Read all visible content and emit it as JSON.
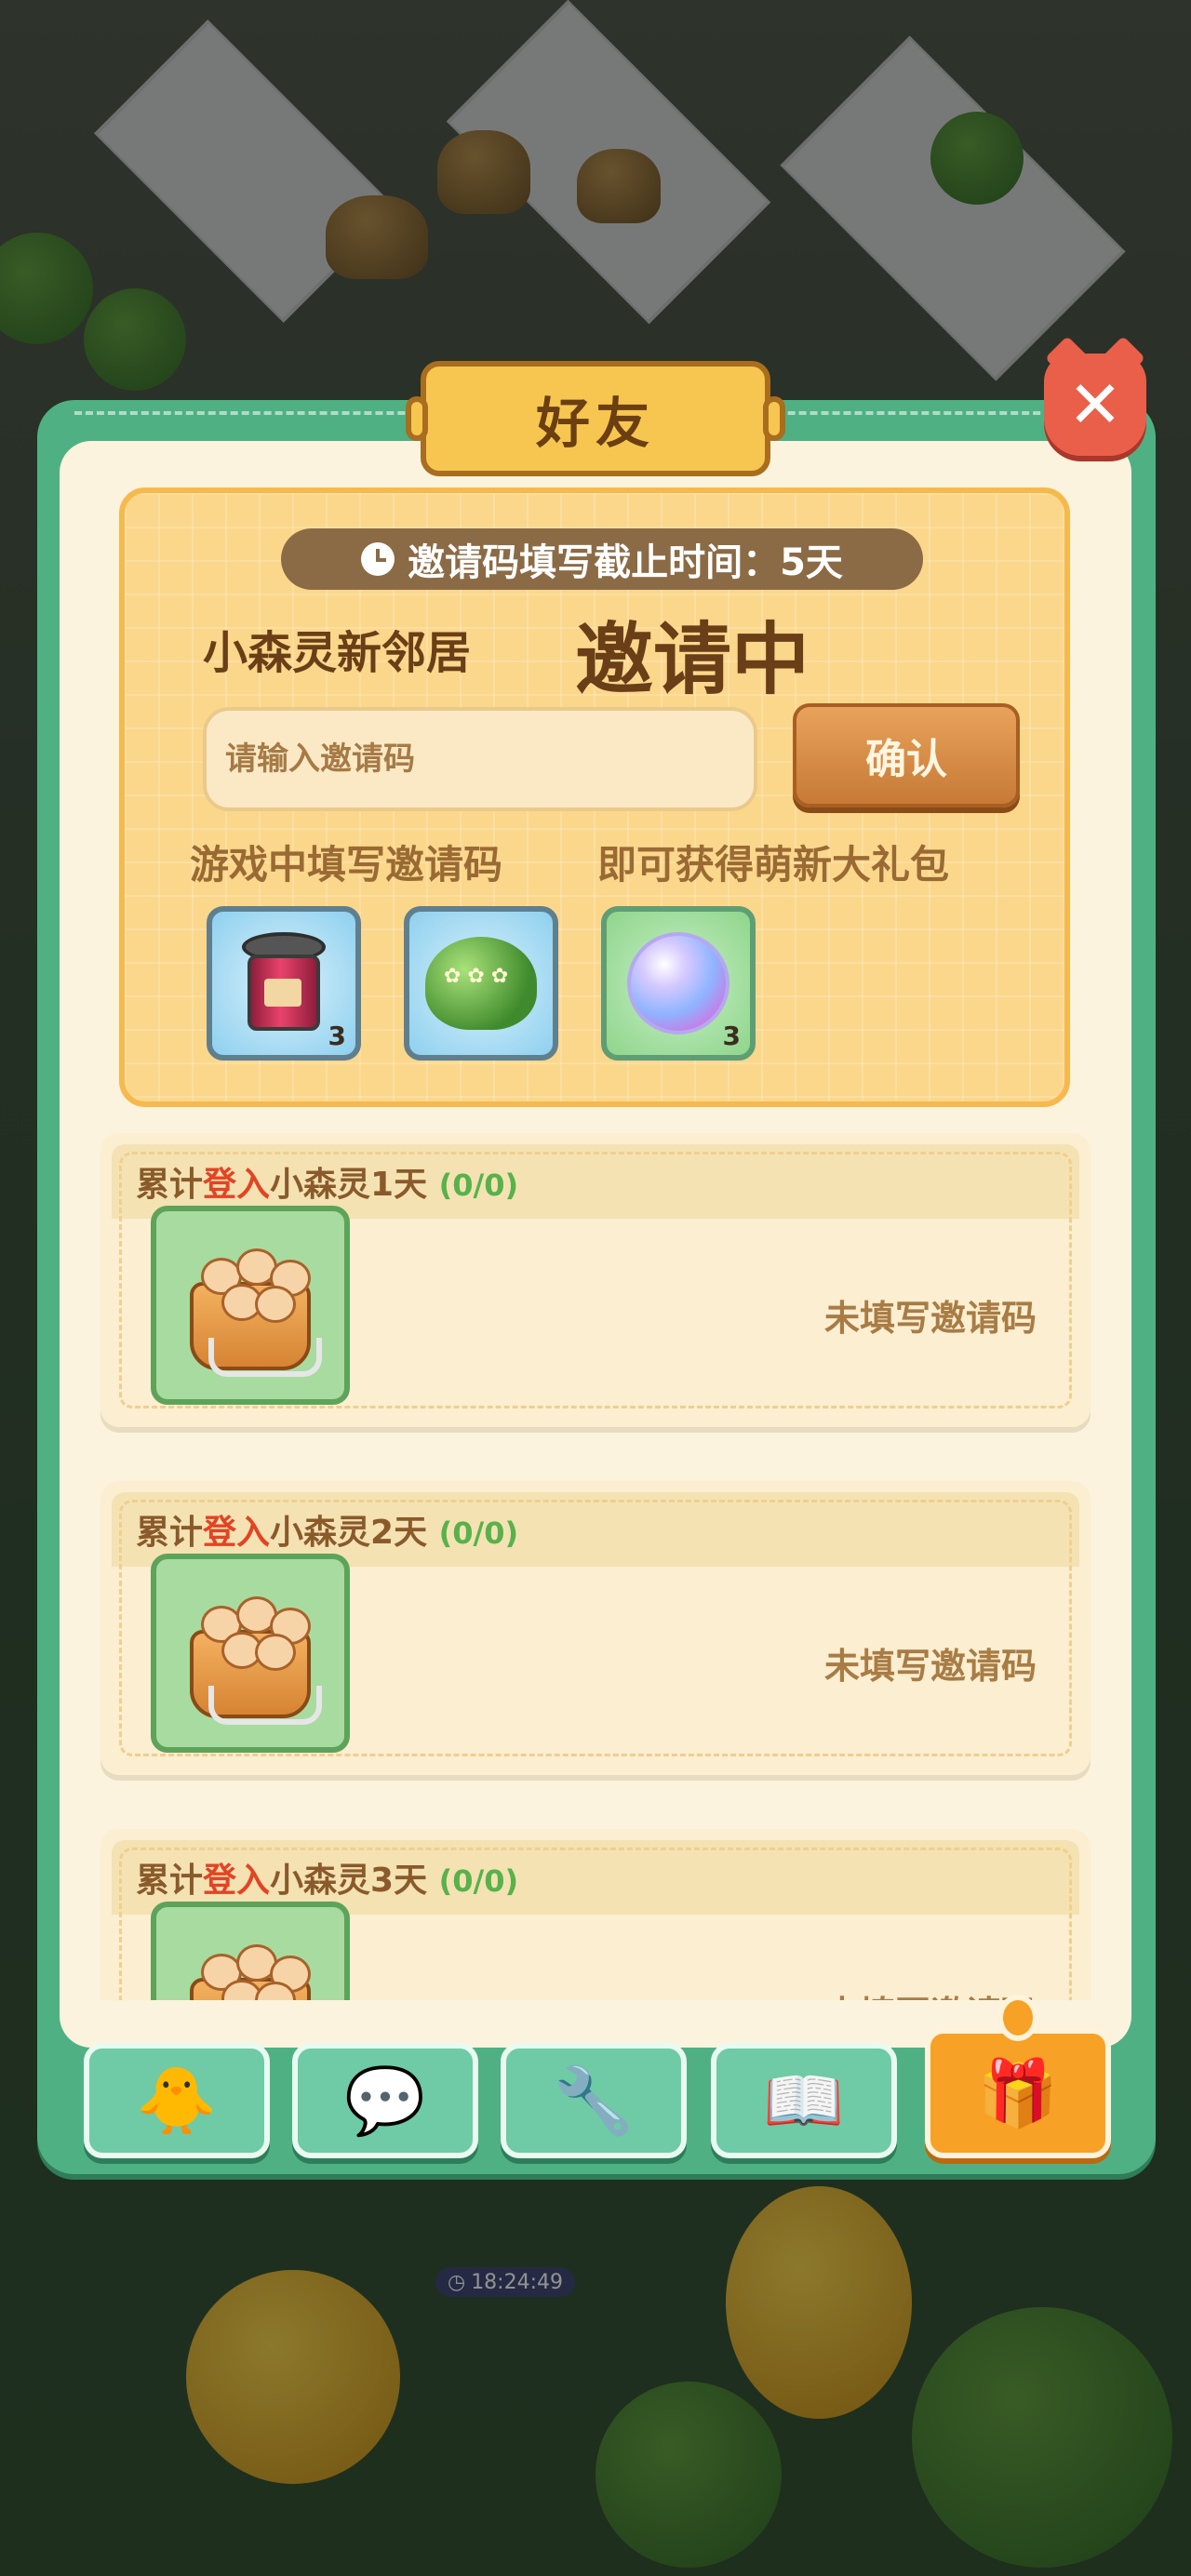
{
  "modal": {
    "title": "好友",
    "close_label": "✕"
  },
  "invite": {
    "deadline_label": "邀请码填写截止时间：5天",
    "lead_text": "小森灵新邻居",
    "status_text": "邀请中",
    "input_placeholder": "请输入邀请码",
    "input_value": "",
    "confirm_label": "确认",
    "hint_left": "游戏中填写邀请码",
    "hint_right": "即可获得萌新大礼包",
    "items": [
      {
        "icon": "jar-icon",
        "quantity": "3"
      },
      {
        "icon": "bush-icon",
        "quantity": ""
      },
      {
        "icon": "orb-icon",
        "quantity": "3"
      }
    ]
  },
  "rewards": [
    {
      "prefix": "累计",
      "highlight": "登入",
      "suffix": "小森灵1天",
      "progress": "(0/0)",
      "status": "未填写邀请码",
      "icon": "puppy-basket-icon"
    },
    {
      "prefix": "累计",
      "highlight": "登入",
      "suffix": "小森灵2天",
      "progress": "(0/0)",
      "status": "未填写邀请码",
      "icon": "puppy-basket-icon"
    },
    {
      "prefix": "累计",
      "highlight": "登入",
      "suffix": "小森灵3天",
      "progress": "(0/0)",
      "status": "未填写邀请码",
      "icon": "puppy-basket-icon"
    }
  ],
  "tabs": [
    {
      "name": "chick",
      "icon": "chick-icon",
      "glyph": "🐥",
      "active": false
    },
    {
      "name": "chat",
      "icon": "chat-icon",
      "glyph": "💬",
      "active": false
    },
    {
      "name": "tools",
      "icon": "wrench-icon",
      "glyph": "🔧",
      "active": false
    },
    {
      "name": "guide",
      "icon": "book-icon",
      "glyph": "📖",
      "active": false
    },
    {
      "name": "gift",
      "icon": "gift-icon",
      "glyph": "🎁",
      "active": true
    }
  ],
  "scene": {
    "timer": "18:24:49"
  },
  "colors": {
    "frame_green": "#4fb183",
    "title_gold": "#f6c650",
    "close_red": "#ea5f4a",
    "highlight_red": "#e24424",
    "progress_green": "#58b24a",
    "active_tab_orange": "#f7a127"
  }
}
